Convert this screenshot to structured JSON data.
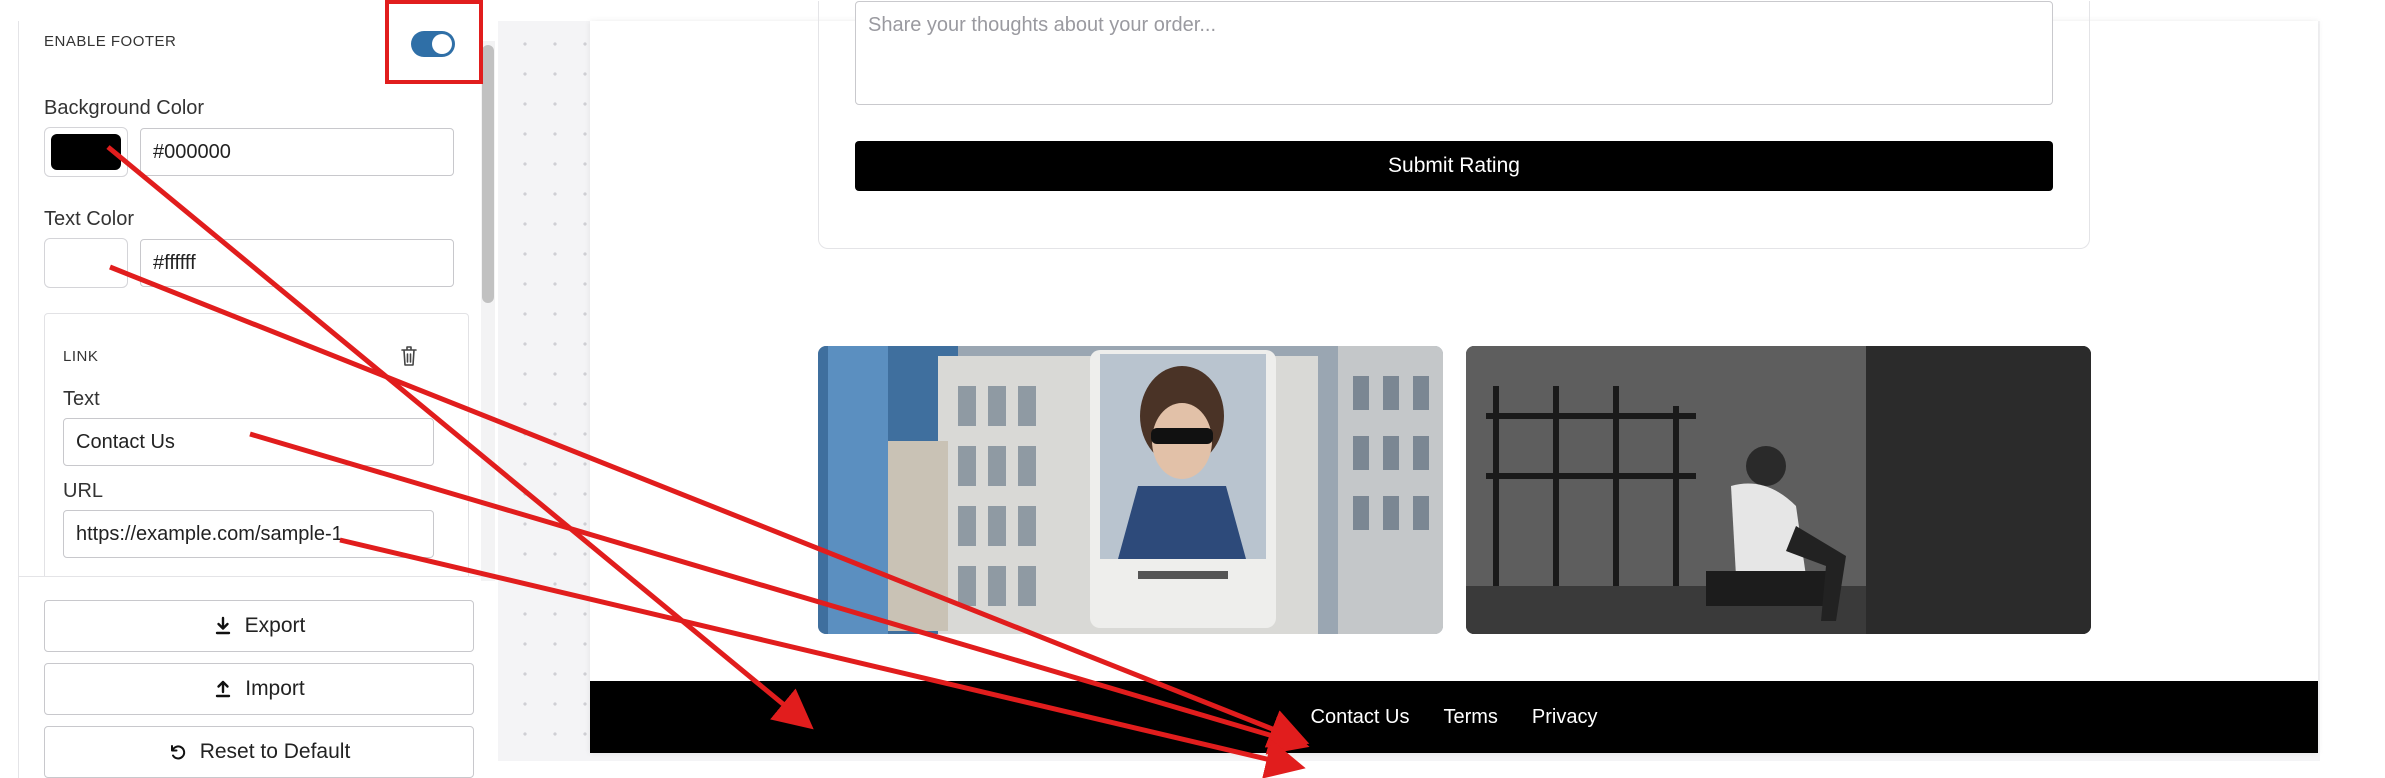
{
  "settings": {
    "section_title": "ENABLE FOOTER",
    "toggle_on": true,
    "background_color": {
      "label": "Background Color",
      "value": "#000000",
      "swatch": "#000000"
    },
    "text_color": {
      "label": "Text Color",
      "value": "#ffffff",
      "swatch": "#ffffff"
    },
    "link": {
      "title": "LINK",
      "text_label": "Text",
      "text_value": "Contact Us",
      "url_label": "URL",
      "url_value": "https://example.com/sample-1"
    },
    "actions": {
      "export": "Export",
      "import": "Import",
      "reset": "Reset to Default"
    }
  },
  "preview": {
    "feedback_placeholder": "Share your thoughts about your order...",
    "submit_label": "Submit Rating",
    "footer_links": [
      "Contact Us",
      "Terms",
      "Privacy"
    ]
  },
  "colors": {
    "accent": "#2f6fa7",
    "annotation": "#e11d1d"
  }
}
